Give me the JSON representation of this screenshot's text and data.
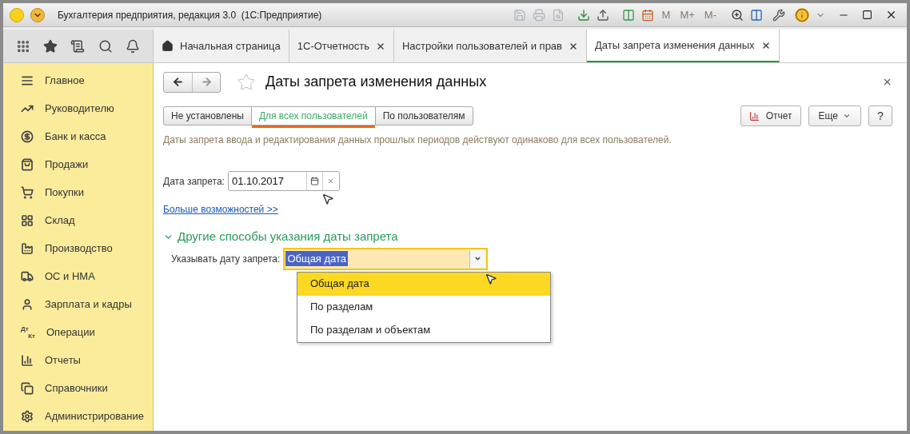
{
  "window": {
    "title": "Бухгалтерия предприятия, редакция 3.0  (1С:Предприятие)",
    "memory_buttons": [
      "M",
      "M+",
      "M-"
    ]
  },
  "tabs": [
    {
      "label": "Начальная страница",
      "kind": "home",
      "selected": false
    },
    {
      "label": "1С-Отчетность",
      "kind": "closable",
      "selected": false
    },
    {
      "label": "Настройки пользователей и прав",
      "kind": "closable",
      "selected": false
    },
    {
      "label": "Даты запрета изменения данных",
      "kind": "closable",
      "selected": true
    }
  ],
  "sidebar": {
    "items": [
      {
        "label": "Главное",
        "kind": "menu"
      },
      {
        "label": "Руководителю",
        "kind": "trend"
      },
      {
        "label": "Банк и касса",
        "kind": "ruble"
      },
      {
        "label": "Продажи",
        "kind": "bag"
      },
      {
        "label": "Покупки",
        "kind": "cart"
      },
      {
        "label": "Склад",
        "kind": "warehouse"
      },
      {
        "label": "Производство",
        "kind": "factory"
      },
      {
        "label": "ОС и НМА",
        "kind": "truck"
      },
      {
        "label": "Зарплата и кадры",
        "kind": "person"
      },
      {
        "label": "Операции",
        "kind": "debit",
        "icon_text": [
          "Дт",
          "Кт"
        ]
      },
      {
        "label": "Отчеты",
        "kind": "bars"
      },
      {
        "label": "Справочники",
        "kind": "books"
      },
      {
        "label": "Администрирование",
        "kind": "gear"
      }
    ]
  },
  "form": {
    "title": "Даты запрета изменения данных",
    "modes": [
      {
        "label": "Не установлены",
        "selected": false
      },
      {
        "label": "Для всех пользователей",
        "selected": true
      },
      {
        "label": "По пользователям",
        "selected": false
      }
    ],
    "report_button": "Отчет",
    "more_button": "Еще",
    "help_button": "?",
    "description": "Даты запрета ввода и редактирования данных прошлых периодов действуют одинаково для всех пользователей.",
    "date_label": "Дата запрета:",
    "date_value": "01.10.2017",
    "more_link": "Больше возможностей >>",
    "group": {
      "title": "Другие способы указания даты запрета",
      "expanded": true
    },
    "combo_label": "Указывать дату запрета:",
    "combo_value": "Общая дата",
    "options": [
      {
        "label": "Общая дата",
        "selected": true
      },
      {
        "label": "По разделам",
        "selected": false
      },
      {
        "label": "По разделам и объектам",
        "selected": false
      }
    ]
  }
}
